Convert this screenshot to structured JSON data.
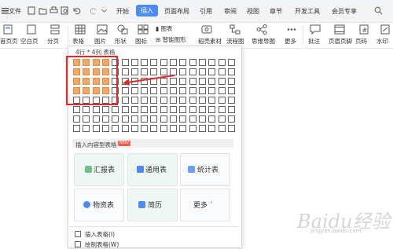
{
  "menu": {
    "file": "文件",
    "tabs": [
      "开始",
      "插入",
      "页面布局",
      "引用",
      "审阅",
      "视图",
      "章节",
      "开发工具",
      "会员专享"
    ],
    "active_tab": "插入",
    "search_icon": "search-icon"
  },
  "ribbon": {
    "items": [
      "首页页",
      "空白页",
      "分页",
      "表格",
      "图片",
      "形状",
      "图标",
      "稻壳素材",
      "流程图",
      "思维导图",
      "更多",
      "批注",
      "页眉页脚",
      "页码",
      "水印"
    ],
    "mini": [
      "图表",
      "智能图形"
    ]
  },
  "panel": {
    "grid_label": "4行 * 4列 表格",
    "section_title": "插入内容型表格",
    "new_badge": "NEW",
    "templates": [
      "汇报表",
      "通用表",
      "统计表",
      "物资表",
      "简历",
      "更多"
    ],
    "more_arrow": "›",
    "bottom": [
      "插入表格(I)",
      "绘制表格(W)"
    ]
  },
  "grid": {
    "rows": 8,
    "cols": 17,
    "selected_rows": 4,
    "selected_cols": 4
  },
  "watermark": {
    "text": "Baidu经验",
    "sub": "jingyan.baidu.com"
  },
  "colors": {
    "accent": "#4c8bf5",
    "highlight": "#f4a868",
    "annotation": "#e02a2a"
  }
}
